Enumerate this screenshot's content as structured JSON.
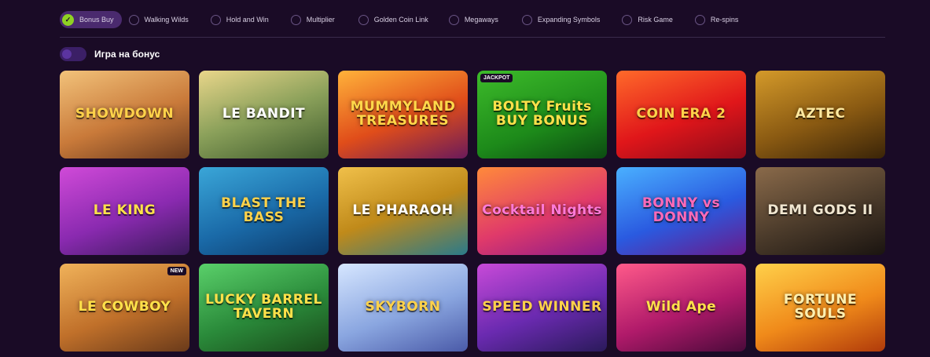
{
  "filters": [
    {
      "label": "Bonus Buy",
      "active": true
    },
    {
      "label": "Walking Wilds",
      "active": false
    },
    {
      "label": "Hold and Win",
      "active": false
    },
    {
      "label": "Multiplier",
      "active": false
    },
    {
      "label": "Golden Coin Link",
      "active": false
    },
    {
      "label": "Megaways",
      "active": false
    },
    {
      "label": "Expanding Symbols",
      "active": false
    },
    {
      "label": "Risk Game",
      "active": false
    },
    {
      "label": "Re-spins",
      "active": false
    }
  ],
  "bonus_toggle": {
    "label": "Игра на бонус"
  },
  "games": [
    {
      "title": "SHOWDOWN",
      "bg": "linear-gradient(160deg,#f2c27a,#c97a3a 55%,#6b3a1e)",
      "color": "#ffd24a"
    },
    {
      "title": "LE BANDIT",
      "bg": "linear-gradient(160deg,#e9d68a,#8aa05a 50%,#3e5a2c)",
      "color": "#ffffff"
    },
    {
      "title": "MUMMYLAND TREASURES",
      "bg": "linear-gradient(160deg,#ffb23a,#e04d1a 55%,#6a1a5a)",
      "color": "#ffd84a"
    },
    {
      "title": "BOLTY Fruits BUY BONUS",
      "bg": "linear-gradient(160deg,#3dbb2a,#1d8a1a 60%,#0c4a12)",
      "color": "#ffe14a",
      "badge": "JACKPOT",
      "badge_pos": "left"
    },
    {
      "title": "COIN ERA 2",
      "bg": "linear-gradient(160deg,#ff6a2a,#e0161a 55%,#8a0a1a)",
      "color": "#ffd24a"
    },
    {
      "title": "AZTEC",
      "bg": "linear-gradient(160deg,#d49a2a,#8a5a12 55%,#3a2408)",
      "color": "#ffe9a0"
    },
    {
      "title": "LE KING",
      "bg": "linear-gradient(160deg,#d04ad8,#8a2ab0 55%,#3a1a5a)",
      "color": "#ffe14a"
    },
    {
      "title": "BLAST THE BASS",
      "bg": "linear-gradient(160deg,#3aa6d8,#1a6aa8 55%,#0c3a6a)",
      "color": "#ffd24a"
    },
    {
      "title": "LE PHARAOH",
      "bg": "linear-gradient(160deg,#f0c04a,#c08a1a 50%,#2a7a8a)",
      "color": "#ffffff"
    },
    {
      "title": "Cocktail Nights",
      "bg": "linear-gradient(160deg,#ff8a3a,#e03a6a 55%,#8a1a8a)",
      "color": "#ff7ad8"
    },
    {
      "title": "BONNY vs DONNY",
      "bg": "linear-gradient(160deg,#4ab0ff,#2a5ae0 55%,#6a1a8a)",
      "color": "#ff6ab8"
    },
    {
      "title": "DEMI GODS II",
      "bg": "linear-gradient(160deg,#8a6a4a,#4a3a2a 55%,#1a1410)",
      "color": "#f0e6d0"
    },
    {
      "title": "LE COWBOY",
      "bg": "linear-gradient(160deg,#f0b25a,#c0702a 55%,#6a3a1a)",
      "color": "#ffe14a",
      "badge": "NEW",
      "badge_pos": "right"
    },
    {
      "title": "LUCKY BARREL TAVERN",
      "bg": "linear-gradient(160deg,#5ad06a,#2a8a3a 55%,#1a4a1a)",
      "color": "#ffe14a"
    },
    {
      "title": "SKYBORN",
      "bg": "linear-gradient(160deg,#d6e6ff,#8aa6e0 55%,#4a5aa8)",
      "color": "#ffd24a"
    },
    {
      "title": "SPEED WINNER",
      "bg": "linear-gradient(160deg,#c84ad8,#6a2ab0 55%,#2a1a5a)",
      "color": "#ffd24a"
    },
    {
      "title": "Wild Ape",
      "bg": "linear-gradient(160deg,#ff5a8a,#b01a6a 55%,#4a0a3a)",
      "color": "#ffe14a"
    },
    {
      "title": "FORTUNE SOULS",
      "bg": "linear-gradient(160deg,#ffd04a,#f08a1a 55%,#b03a0a)",
      "color": "#fff0b0"
    }
  ]
}
